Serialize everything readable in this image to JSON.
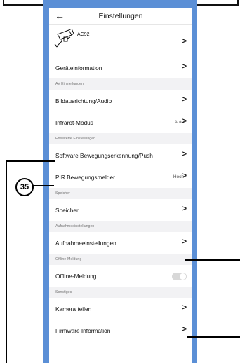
{
  "header": {
    "back_icon": "arrow-left-icon",
    "title": "Einstellungen"
  },
  "device": {
    "name": "AC92",
    "icon": "camera-icon"
  },
  "rows": {
    "device_info": "Geräteinformation",
    "av_section": "AV Einstellungen",
    "image_audio": "Bildausrichtung/Audio",
    "infrared": "Infrarot-Modus",
    "infrared_value": "Auto",
    "advanced_section": "Erweiterte Einstellungen",
    "software_motion": "Software Bewegungserkennung/Push",
    "pir": "PIR Bewegungsmelder",
    "pir_value": "Hoch",
    "storage_section": "Speicher",
    "storage": "Speicher",
    "recording_section": "Aufnahmeeinstellungen",
    "recording": "Aufnahmeeinstellungen",
    "offline_section": "Offline-Meldung",
    "offline": "Offline-Meldung",
    "other_section": "Sonstiges",
    "share": "Kamera teilen",
    "firmware": "Firmware Information"
  },
  "callout": {
    "number": "35"
  },
  "colors": {
    "frame": "#5b8fd6",
    "section_bg": "#f2f2f4",
    "toggle_off": "#d8d8d8"
  }
}
